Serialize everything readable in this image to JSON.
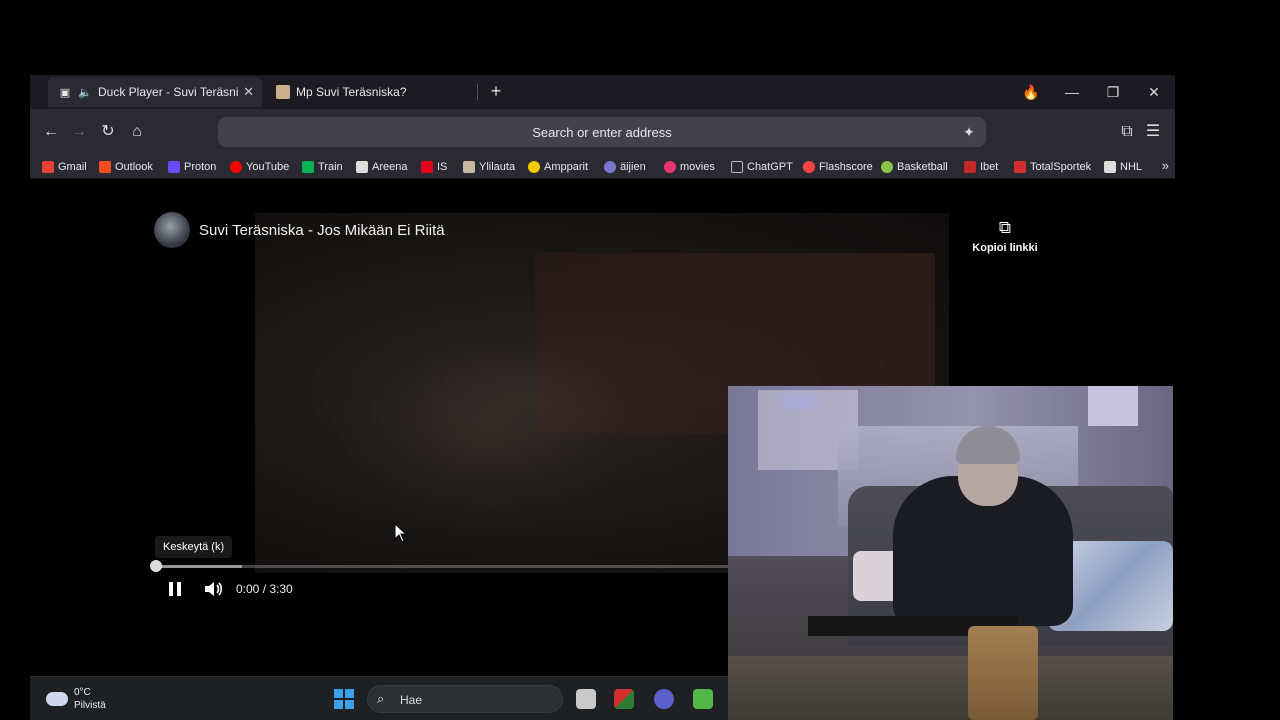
{
  "browser": {
    "tabs": [
      {
        "title": "Duck Player - Suvi Teräsniska",
        "close": "✕",
        "active": true
      },
      {
        "title": "Mp Suvi Teräsniska?",
        "active": false
      }
    ],
    "new_tab": "+",
    "window_controls": {
      "fire": "🔥",
      "minimize": "—",
      "restore": "❐",
      "close": "✕"
    },
    "address_placeholder": "Search or enter address",
    "nav": {
      "back": "←",
      "forward": "→",
      "reload": "↻",
      "home": "⌂"
    },
    "bookmarks": [
      {
        "label": "Gmail",
        "color": "#ea4335"
      },
      {
        "label": "Outlook",
        "color": "#f25022"
      },
      {
        "label": "Proton",
        "color": "#6d4aff"
      },
      {
        "label": "YouTube",
        "color": "#ff0000"
      },
      {
        "label": "Train",
        "color": "#00b451"
      },
      {
        "label": "Areena",
        "color": "#dddddd"
      },
      {
        "label": "IS",
        "color": "#e3001b"
      },
      {
        "label": "Ylilauta",
        "color": "#c8b7a0"
      },
      {
        "label": "Ampparit",
        "color": "#f7c900"
      },
      {
        "label": "äijien",
        "color": "#7777cc"
      },
      {
        "label": "movies",
        "color": "#e8336b"
      },
      {
        "label": "ChatGPT",
        "color": "#bbbbbb"
      },
      {
        "label": "Flashscore",
        "color": "#ff4444"
      },
      {
        "label": "Basketball",
        "color": "#8bc34a"
      },
      {
        "label": "Ibet",
        "color": "#c62828"
      },
      {
        "label": "TotalSportek",
        "color": "#d32f2f"
      },
      {
        "label": "NHL",
        "color": "#dddddd"
      }
    ],
    "bookmarks_more": "»"
  },
  "player": {
    "title": "Suvi Teräsniska - Jos Mikään Ei Riitä",
    "copy_link_label": "Kopioi linkki",
    "tooltip": "Keskeytä (k)",
    "time": "0:00 / 3:30",
    "progress": 0.0,
    "buffered": 0.15
  },
  "taskbar": {
    "temperature": "0°C",
    "condition": "Pilvistä",
    "search_placeholder": "Hae"
  }
}
